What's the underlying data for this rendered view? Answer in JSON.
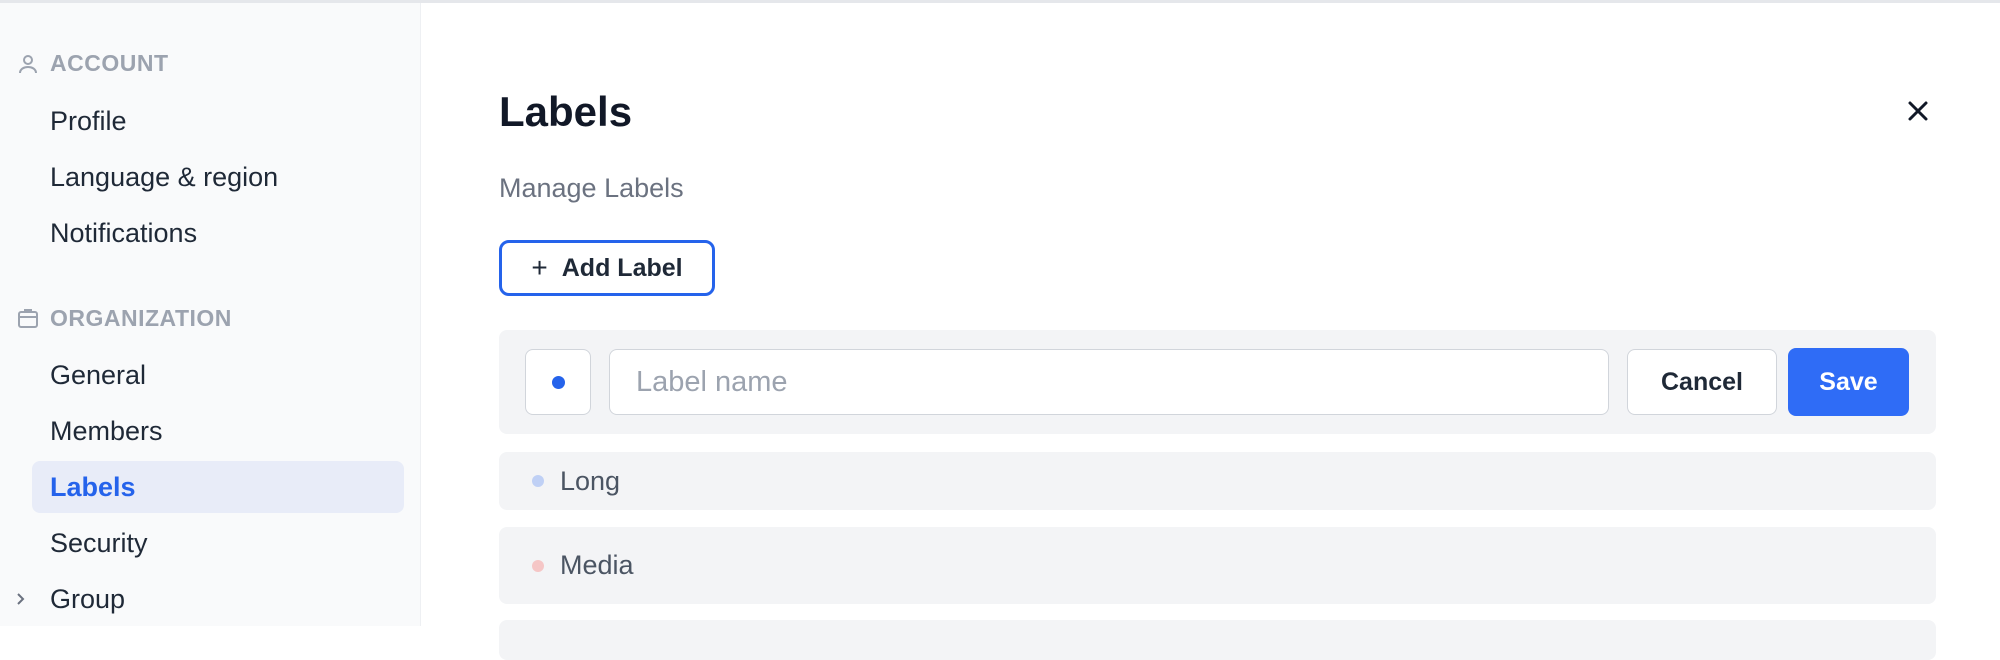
{
  "sidebar": {
    "account_header": "ACCOUNT",
    "account_items": [
      {
        "label": "Profile"
      },
      {
        "label": "Language & region"
      },
      {
        "label": "Notifications"
      }
    ],
    "organization_header": "ORGANIZATION",
    "organization_items": [
      {
        "label": "General"
      },
      {
        "label": "Members"
      },
      {
        "label": "Labels",
        "active": true
      },
      {
        "label": "Security"
      },
      {
        "label": "Group",
        "expandable": true
      }
    ]
  },
  "main": {
    "title": "Labels",
    "subtitle": "Manage Labels",
    "add_button_label": "Add Label",
    "editor": {
      "input_value": "",
      "input_placeholder": "Label name",
      "selected_color": "#2563eb",
      "cancel_label": "Cancel",
      "save_label": "Save"
    },
    "labels": [
      {
        "name": "Long",
        "color": "#bfd0f5"
      },
      {
        "name": "Media",
        "color": "#f5c6c6"
      }
    ]
  },
  "icons": {
    "account": "user-icon",
    "organization": "building-icon",
    "close": "close-icon",
    "add": "plus-icon",
    "expand": "chevron-right-icon"
  },
  "colors": {
    "accent": "#2563eb",
    "save_button": "#2f6cf6",
    "active_nav_bg": "#e8ecf8"
  }
}
